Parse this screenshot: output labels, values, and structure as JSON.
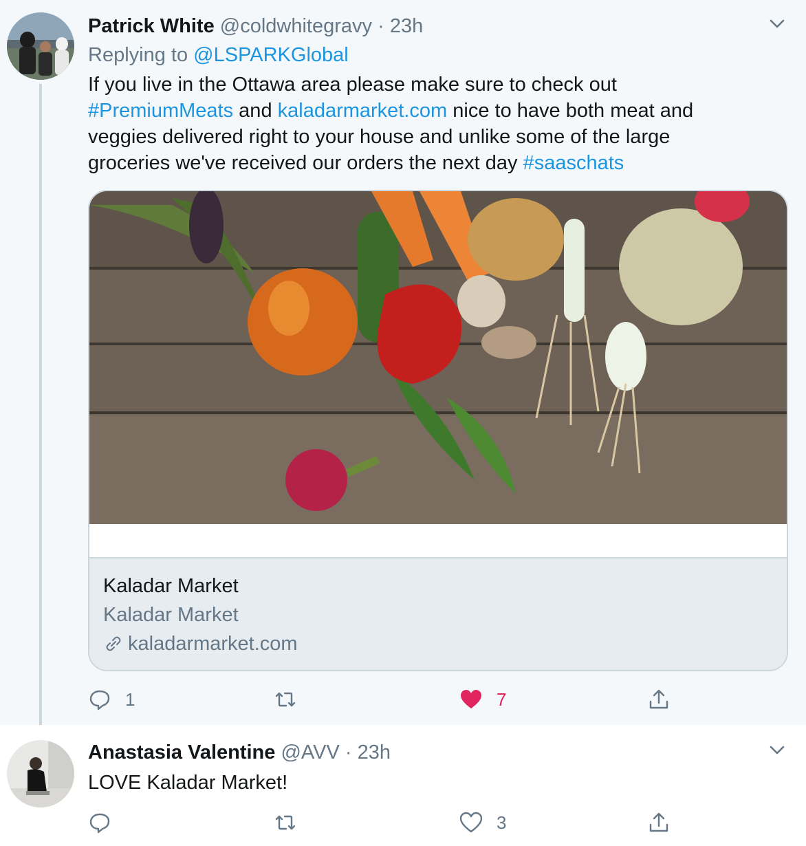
{
  "tweets": [
    {
      "name": "Patrick White",
      "handle": "@coldwhitegravy",
      "dot": "·",
      "time": "23h",
      "replying_prefix": "Replying to ",
      "replying_handle": "@LSPARKGlobal",
      "body": {
        "line1": "If you live in the Ottawa area please make sure to check out",
        "line2_hashtag": "#PremiumMeats",
        "line2_and": " and ",
        "line2_link": "kaladarmarket.com",
        "line2_rest": " nice to have both meat and",
        "line3": "veggies delivered right to your house and unlike some of the large",
        "line4_text": "groceries we've received our orders the next day ",
        "line4_hashtag": "#saaschats"
      },
      "card": {
        "title": "Kaladar Market",
        "description": "Kaladar Market",
        "domain": "kaladarmarket.com"
      },
      "actions": {
        "replies": "1",
        "retweets": "",
        "likes": "7"
      }
    },
    {
      "name": "Anastasia Valentine",
      "handle": "@AVV",
      "dot": "·",
      "time": "23h",
      "body": "LOVE Kaladar Market!",
      "actions": {
        "replies": "",
        "retweets": "",
        "likes": "3"
      }
    }
  ],
  "colors": {
    "link": "#1b95e0",
    "like": "#e0245e",
    "muted": "#657786",
    "background_focus": "#f5f8fa"
  },
  "icons": [
    "chevron-down-icon",
    "reply-icon",
    "retweet-icon",
    "heart-icon",
    "share-icon",
    "link-icon"
  ]
}
